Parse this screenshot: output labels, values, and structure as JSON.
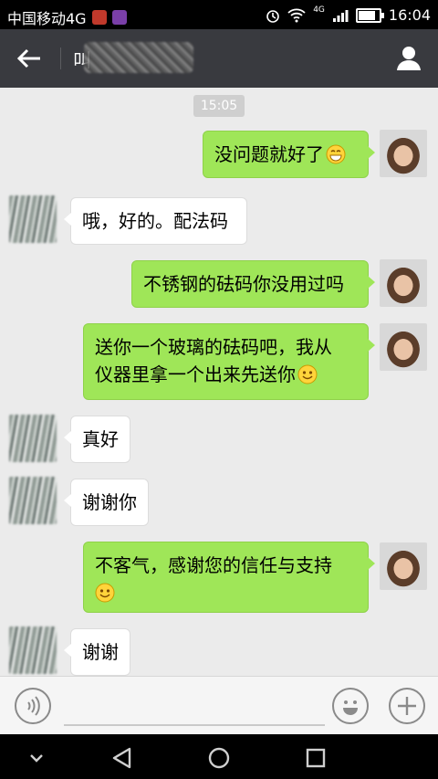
{
  "status_bar": {
    "carrier": "中国移动4G",
    "time": "16:04",
    "network": "4G",
    "battery_level": 0.75,
    "icons": [
      "notification-app-icon",
      "notification-app-icon",
      "alarm-icon",
      "wifi-icon",
      "signal-icon",
      "battery-icon"
    ]
  },
  "title_bar": {
    "title": "叫",
    "back_icon": "arrow-left-icon",
    "profile_icon": "person-icon"
  },
  "chat": {
    "timestamp": "15:05",
    "messages": [
      {
        "sender": "me",
        "text": "没问题就好了",
        "emoji": "grin-emoji"
      },
      {
        "sender": "them",
        "text": "哦，好的。配法码"
      },
      {
        "sender": "me",
        "text": "不锈钢的砝码你没用过吗"
      },
      {
        "sender": "me",
        "text_line1": "送你一个玻璃的砝码吧，我从",
        "text_line2": "仪器里拿一个出来先送你",
        "emoji": "smile-emoji"
      },
      {
        "sender": "them",
        "text": "真好"
      },
      {
        "sender": "them",
        "text": "谢谢你"
      },
      {
        "sender": "me",
        "text_line1": "不客气，感谢您的信任与支持",
        "emoji": "smile-emoji"
      },
      {
        "sender": "them",
        "text": "谢谢"
      }
    ]
  },
  "input_bar": {
    "voice_icon": "voice-icon",
    "emoji_icon": "emoji-icon",
    "plus_icon": "plus-icon"
  },
  "nav_bar": {
    "icons": [
      "chevron-down-icon",
      "back-triangle-icon",
      "home-circle-icon",
      "recents-square-icon"
    ]
  },
  "colors": {
    "title_bar": "#393a3f",
    "chat_bg": "#ebebeb",
    "my_bubble": "#9fe658",
    "their_bubble": "#ffffff"
  }
}
